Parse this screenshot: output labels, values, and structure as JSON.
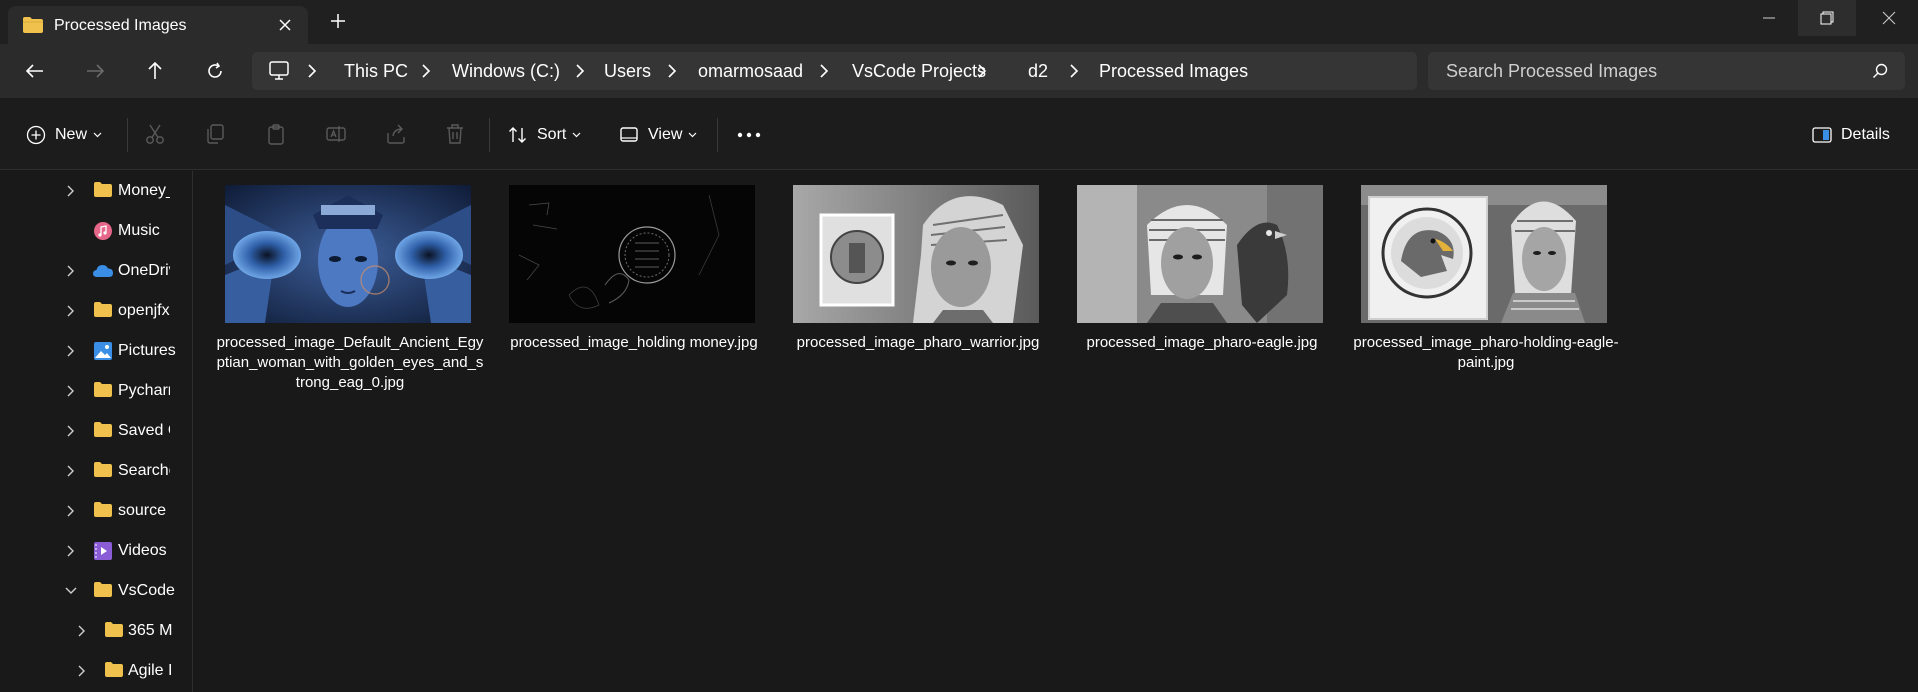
{
  "window": {
    "tab_title": "Processed Images",
    "new_tab_icon": "plus-icon"
  },
  "breadcrumb": {
    "items": [
      "This PC",
      "Windows (C:)",
      "Users",
      "omarmosaad",
      "VsCode Projects",
      "d2",
      "Processed Images"
    ]
  },
  "search": {
    "placeholder": "Search Processed Images"
  },
  "toolbar": {
    "new_label": "New",
    "sort_label": "Sort",
    "view_label": "View",
    "details_label": "Details",
    "disabled_actions": [
      "cut-icon",
      "copy-icon",
      "paste-icon",
      "rename-icon",
      "share-icon",
      "delete-icon"
    ]
  },
  "sidebar": {
    "items": [
      {
        "label": "Money_",
        "icon": "folder-icon",
        "expandable": true
      },
      {
        "label": "Music",
        "icon": "music-icon",
        "expandable": false
      },
      {
        "label": "OneDriv",
        "icon": "onedrive-icon",
        "expandable": true
      },
      {
        "label": "openjfx",
        "icon": "folder-icon",
        "expandable": true
      },
      {
        "label": "Pictures",
        "icon": "pictures-icon",
        "expandable": true
      },
      {
        "label": "Pycharm",
        "icon": "folder-icon",
        "expandable": true
      },
      {
        "label": "Saved G",
        "icon": "folder-icon",
        "expandable": true
      },
      {
        "label": "Searche",
        "icon": "folder-icon",
        "expandable": true
      },
      {
        "label": "source",
        "icon": "folder-icon",
        "expandable": true
      },
      {
        "label": "Videos",
        "icon": "videos-icon",
        "expandable": true
      },
      {
        "label": "VsCode",
        "icon": "folder-icon",
        "expandable": true,
        "expanded": true
      },
      {
        "label": "365 M",
        "icon": "folder-icon",
        "expandable": true,
        "indent": 1
      },
      {
        "label": "Agile I",
        "icon": "folder-icon",
        "expandable": true,
        "indent": 1
      }
    ]
  },
  "files": [
    {
      "name": "processed_image_Default_Ancient_Egyptian_woman_with_golden_eyes_and_strong_eag_0.jpg"
    },
    {
      "name": "processed_image_holding money.jpg"
    },
    {
      "name": "processed_image_pharo_warrior.jpg"
    },
    {
      "name": "processed_image_pharo-eagle.jpg"
    },
    {
      "name": "processed_image_pharo-holding-eagle-paint.jpg"
    }
  ],
  "colors": {
    "background": "#191919",
    "folder": "#f0c24d",
    "accent_blue": "#3a8ee6"
  }
}
